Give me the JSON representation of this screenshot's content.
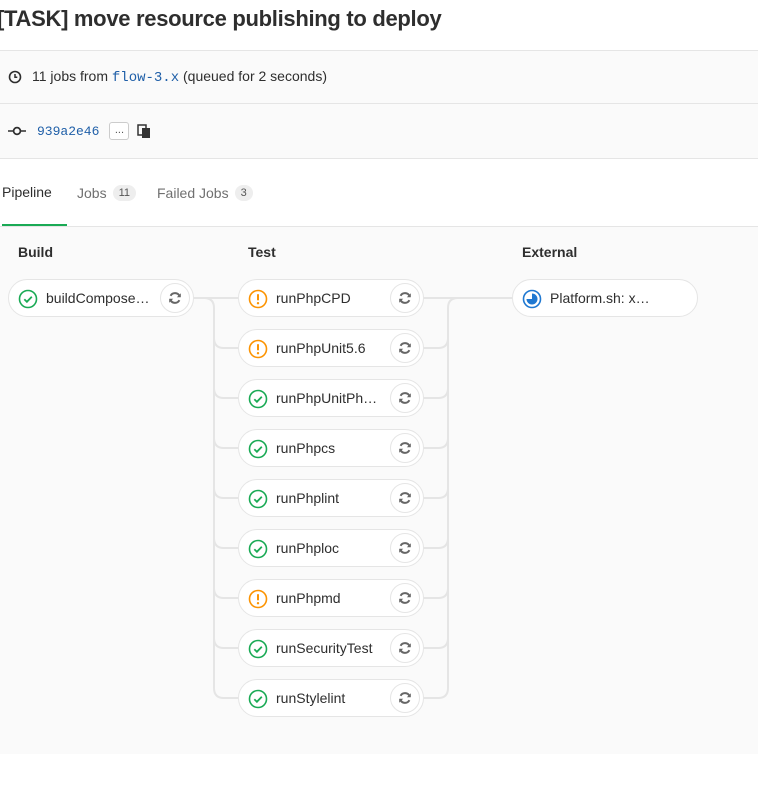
{
  "page": {
    "title": "[TASK] move resource publishing to deploy"
  },
  "summary": {
    "jobs_text": "11 jobs from",
    "branch": "flow-3.x",
    "queued_text": "(queued for 2 seconds)",
    "commit_sha": "939a2e46",
    "ellipsis": "..."
  },
  "tabs": [
    {
      "label": "Pipeline",
      "count": null,
      "active": true
    },
    {
      "label": "Jobs",
      "count": "11",
      "active": false
    },
    {
      "label": "Failed Jobs",
      "count": "3",
      "active": false
    }
  ],
  "stages": [
    {
      "name": "Build",
      "jobs": [
        {
          "name": "buildCompose…",
          "status": "success"
        }
      ]
    },
    {
      "name": "Test",
      "jobs": [
        {
          "name": "runPhpCPD",
          "status": "warning"
        },
        {
          "name": "runPhpUnit5.6",
          "status": "warning"
        },
        {
          "name": "runPhpUnitPh…",
          "status": "success"
        },
        {
          "name": "runPhpcs",
          "status": "success"
        },
        {
          "name": "runPhplint",
          "status": "success"
        },
        {
          "name": "runPhploc",
          "status": "success"
        },
        {
          "name": "runPhpmd",
          "status": "warning"
        },
        {
          "name": "runSecurityTest",
          "status": "success"
        },
        {
          "name": "runStylelint",
          "status": "success"
        }
      ]
    },
    {
      "name": "External",
      "jobs": [
        {
          "name": "Platform.sh: x…",
          "status": "running"
        }
      ]
    }
  ],
  "colors": {
    "success": "#1aaa55",
    "warning": "#fc9403",
    "running": "#1f78d1",
    "tab_active": "#1aaa55",
    "link": "#1f5fa8"
  }
}
